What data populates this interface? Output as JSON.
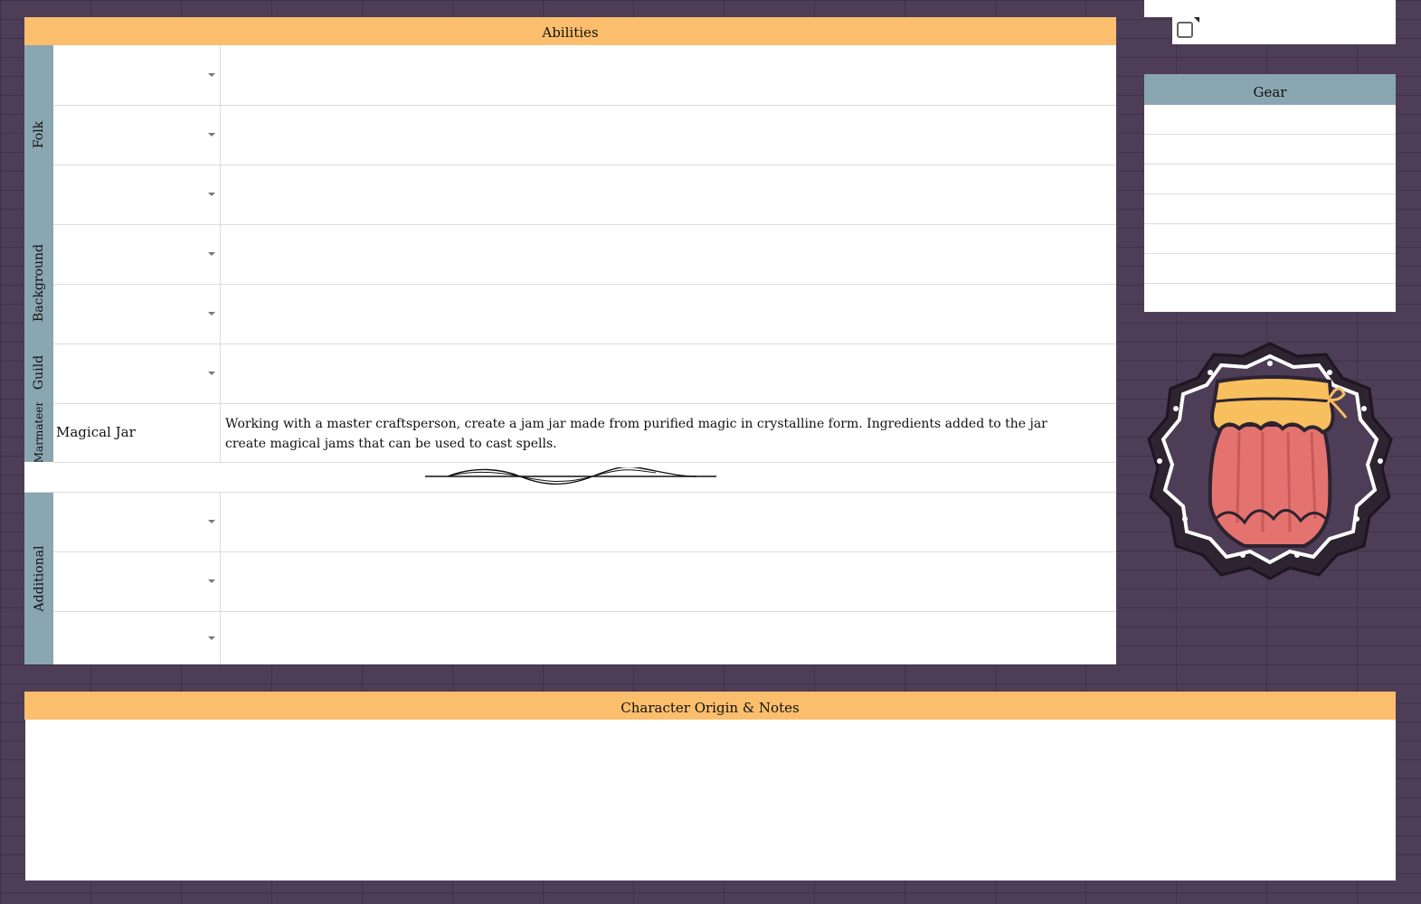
{
  "abilities": {
    "title": "Abilities",
    "groups": {
      "folk": "Folk",
      "background": "Background",
      "guild": "Guild",
      "marmateer": "Marmateer",
      "additional": "Additional"
    },
    "rows": [
      {
        "name": "",
        "description": ""
      },
      {
        "name": "",
        "description": ""
      },
      {
        "name": "",
        "description": ""
      },
      {
        "name": "",
        "description": ""
      },
      {
        "name": "",
        "description": ""
      },
      {
        "name": "",
        "description": ""
      },
      {
        "name": "Magical Jar",
        "description": "Working with a master craftsperson, create a jam jar made from purified magic in crystalline form. Ingredients added to the jar create magical jams that can be used to cast spells."
      },
      {
        "name": "",
        "description": ""
      },
      {
        "name": "",
        "description": ""
      },
      {
        "name": "",
        "description": ""
      }
    ]
  },
  "gear": {
    "title": "Gear",
    "items": [
      "",
      "",
      "",
      "",
      "",
      "",
      ""
    ]
  },
  "notes": {
    "title": "Character Origin & Notes",
    "text": ""
  },
  "checkbox": {
    "checked": false
  },
  "colors": {
    "background": "#4e3d57",
    "header_orange": "#fbbe6d",
    "label_blue": "#8aa6b0",
    "jar_red": "#e4736f",
    "jar_lid": "#f8bf5e"
  },
  "icons": [
    "dropdown-arrow-icon",
    "checkbox-icon",
    "jam-jar-emblem-icon",
    "flourish-divider-icon"
  ]
}
